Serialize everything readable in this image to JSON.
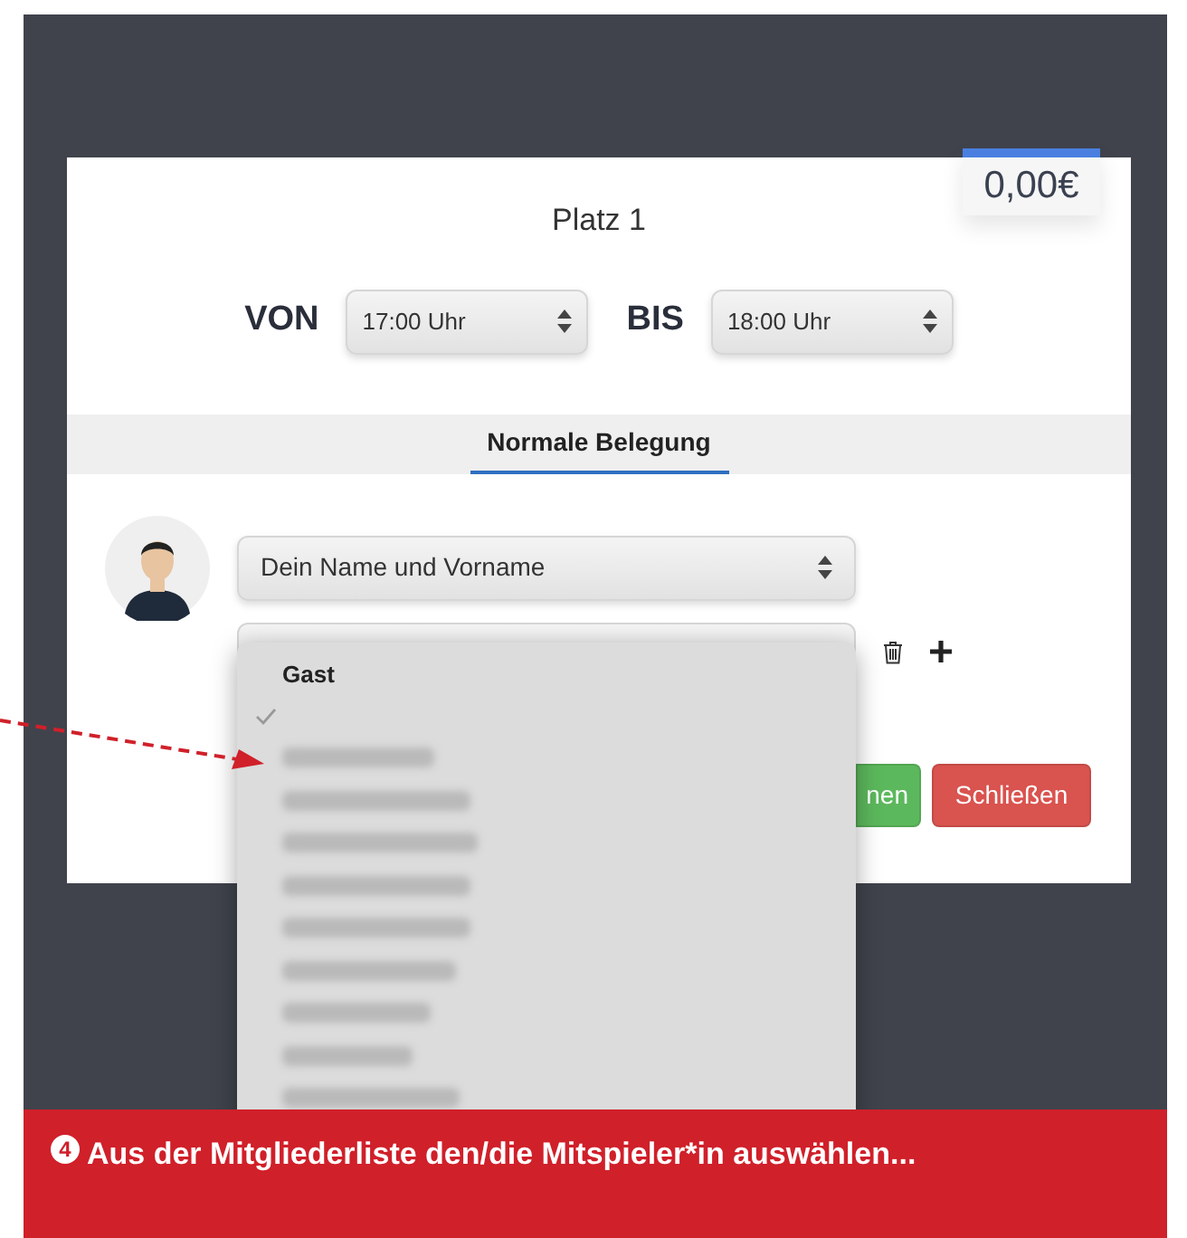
{
  "modal": {
    "price": "0,00€",
    "title": "Platz 1",
    "time": {
      "from_label": "VON",
      "from_value": "17:00 Uhr",
      "to_label": "BIS",
      "to_value": "18:00 Uhr"
    },
    "tabs": [
      {
        "label": "Normale Belegung",
        "selected": true
      }
    ],
    "player_select": {
      "value": "Dein Name und Vorname"
    },
    "buttons": [
      {
        "label": "nen",
        "kind": "confirm"
      },
      {
        "label": "Schließen",
        "kind": "close"
      }
    ]
  },
  "dropdown": {
    "items": [
      {
        "kind": "option",
        "label": "Gast",
        "checked": false
      },
      {
        "kind": "empty",
        "checked": true
      },
      {
        "kind": "redacted"
      },
      {
        "kind": "redacted"
      },
      {
        "kind": "redacted"
      },
      {
        "kind": "redacted"
      },
      {
        "kind": "redacted"
      },
      {
        "kind": "redacted"
      },
      {
        "kind": "redacted"
      },
      {
        "kind": "redacted"
      },
      {
        "kind": "redacted"
      }
    ]
  },
  "caption": {
    "step": "4",
    "text": "Aus der Mitgliederliste den/die Mitspieler*in auswählen..."
  }
}
